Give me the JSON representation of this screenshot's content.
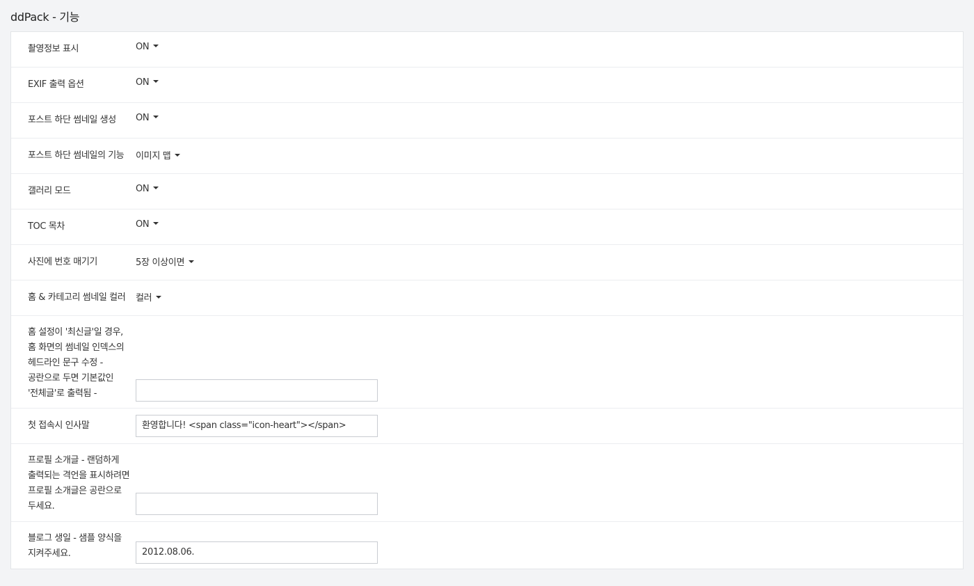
{
  "page": {
    "title": "ddPack - 기능"
  },
  "settings": [
    {
      "label": "촬영정보 표시",
      "value": "ON"
    },
    {
      "label": "EXIF 출력 옵션",
      "value": "ON"
    },
    {
      "label": "포스트 하단 썸네일 생성",
      "value": "ON"
    },
    {
      "label": "포스트 하단 썸네일의 기능",
      "value": "이미지 맵"
    },
    {
      "label": "갤러리 모드",
      "value": "ON"
    },
    {
      "label": "TOC 목차",
      "value": "ON"
    },
    {
      "label": "사진에 번호 매기기",
      "value": "5장 이상이면"
    },
    {
      "label": "홈 & 카테고리 썸네일 컬러",
      "value": "컬러"
    },
    {
      "label": "홈 설정이 '최신글'일 경우, 홈 화면의 썸네일 인덱스의 헤드라인 문구 수정 - 공란으로 두면 기본값인 '전체글'로 출력됨 -",
      "value": ""
    },
    {
      "label": "첫 접속시 인사말",
      "value": "환영합니다! <span class=\"icon-heart\"></span>"
    },
    {
      "label": "프로필 소개글 - 랜덤하게 출력되는 격언을 표시하려면 프로필 소개글은 공란으로 두세요.",
      "value": ""
    },
    {
      "label": "블로그 생일 - 샘플 양식을 지켜주세요.",
      "value": "2012.08.06."
    }
  ],
  "icons": {
    "dropdown": "caret-down-icon"
  }
}
